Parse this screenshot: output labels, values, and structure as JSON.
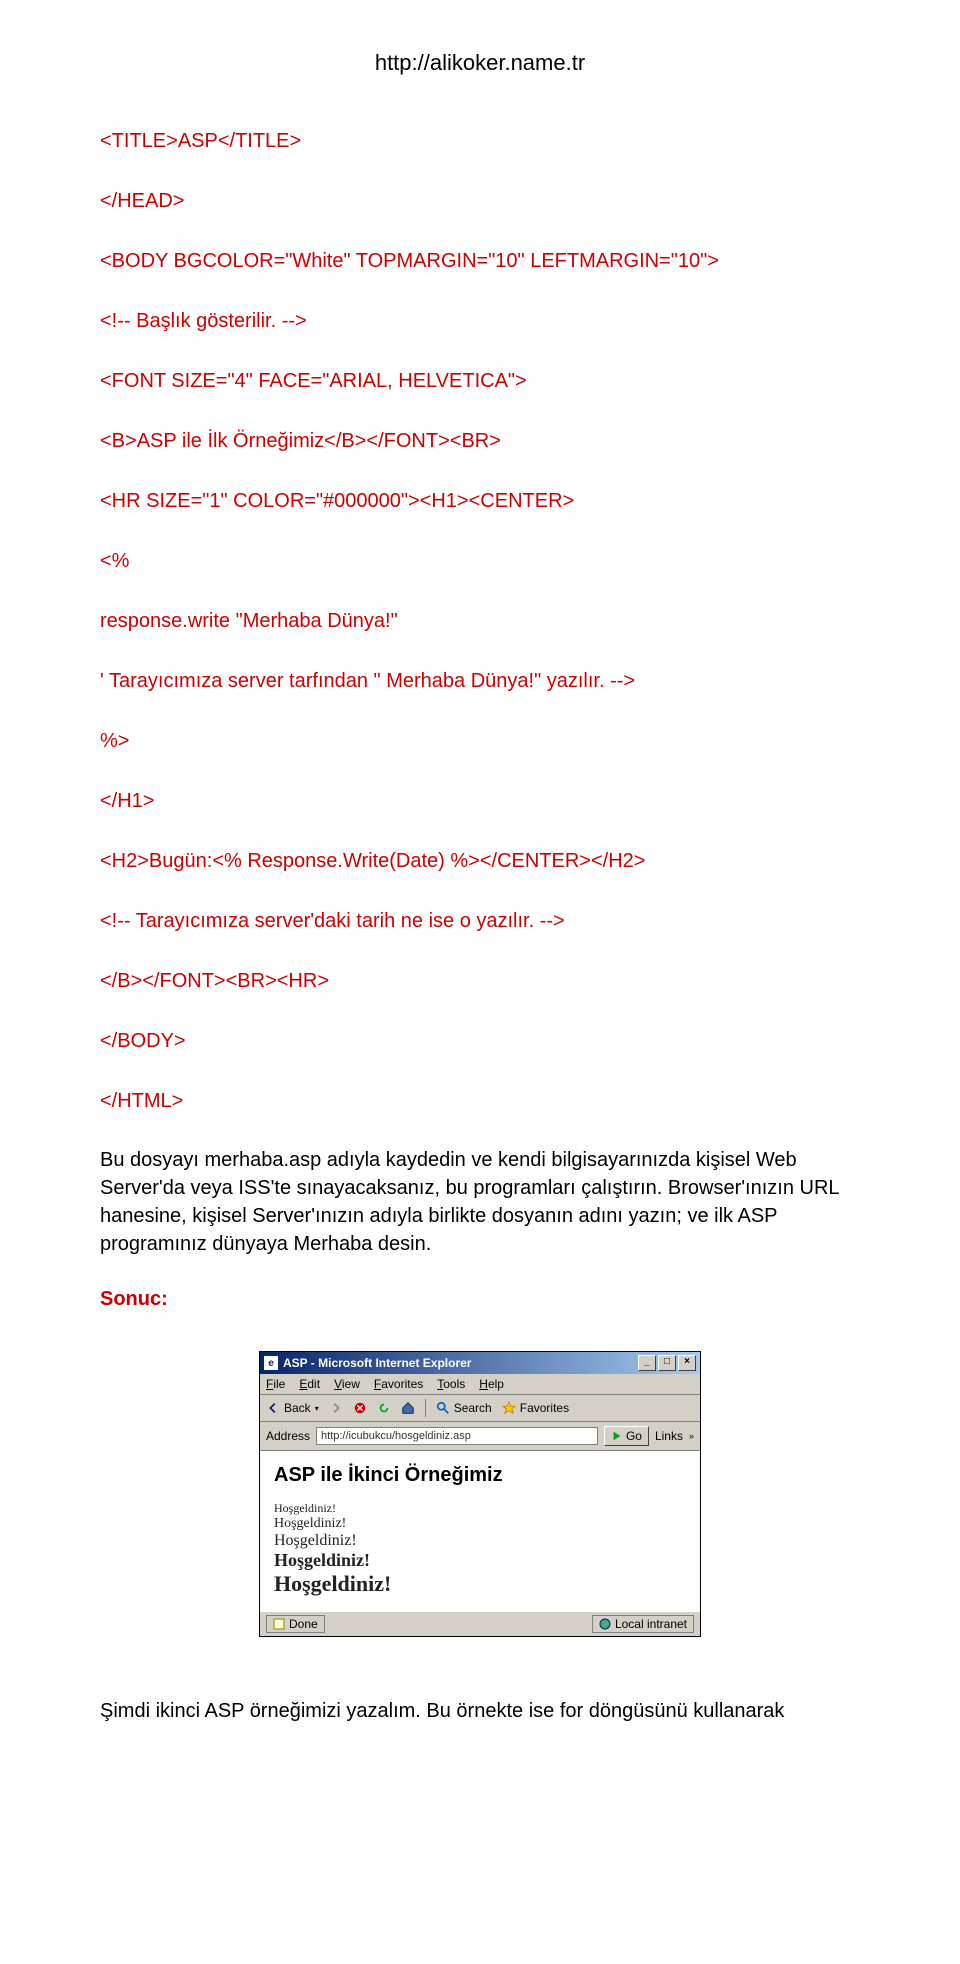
{
  "header_url": "http://alikoker.name.tr",
  "code": {
    "l1": "<TITLE>ASP</TITLE>",
    "l2": "</HEAD>",
    "l3": "<BODY BGCOLOR=\"White\" TOPMARGIN=\"10\" LEFTMARGIN=\"10\">",
    "l4": "<!-- Başlık gösterilir. -->",
    "l5": "<FONT SIZE=\"4\" FACE=\"ARIAL, HELVETICA\">",
    "l6": "<B>ASP ile İlk Örneğimiz</B></FONT><BR>",
    "l7": "<HR SIZE=\"1\" COLOR=\"#000000\"><H1><CENTER>",
    "l8": "<%",
    "l9": "response.write \"Merhaba Dünya!\"",
    "l10": "' Tarayıcımıza server tarfından \" Merhaba Dünya!\" yazılır. -->",
    "l11": "%>",
    "l12": "</H1>",
    "l13": "<H2>Bugün:<% Response.Write(Date) %></CENTER></H2>",
    "l14": "<!-- Tarayıcımıza server'daki tarih ne ise o yazılır. -->",
    "l15": "</B></FONT><BR><HR>",
    "l16": "</BODY>",
    "l17": "</HTML>"
  },
  "paragraph_text": "Bu dosyayı merhaba.asp adıyla kaydedin ve kendi bilgisayarınızda kişisel Web Server'da veya ISS'te sınayacaksanız, bu programları çalıştırın. Browser'ınızın URL hanesine, kişisel Server'ınızın adıyla birlikte dosyanın adını yazın; ve ilk ASP programınız dünyaya Merhaba desin.",
  "sonuc_label": "Sonuc:",
  "browser": {
    "title": "ASP - Microsoft Internet Explorer",
    "menu": {
      "file": "File",
      "edit": "Edit",
      "view": "View",
      "favorites": "Favorites",
      "tools": "Tools",
      "help": "Help"
    },
    "toolbar": {
      "back": "Back",
      "search": "Search",
      "favorites": "Favorites"
    },
    "address_label": "Address",
    "url": "http://icubukcu/hosgeldiniz.asp",
    "go": "Go",
    "links": "Links",
    "page_heading": "ASP ile İkinci Örneğimiz",
    "greetings": {
      "g1": "Hoşgeldiniz!",
      "g2": "Hoşgeldiniz!",
      "g3": "Hoşgeldiniz!",
      "g4": "Hoşgeldiniz!",
      "g5": "Hoşgeldiniz!"
    },
    "status_done": "Done",
    "status_zone": "Local intranet"
  },
  "footer_text": "Şimdi ikinci ASP örneğimizi yazalım. Bu örnekte ise for döngüsünü kullanarak"
}
